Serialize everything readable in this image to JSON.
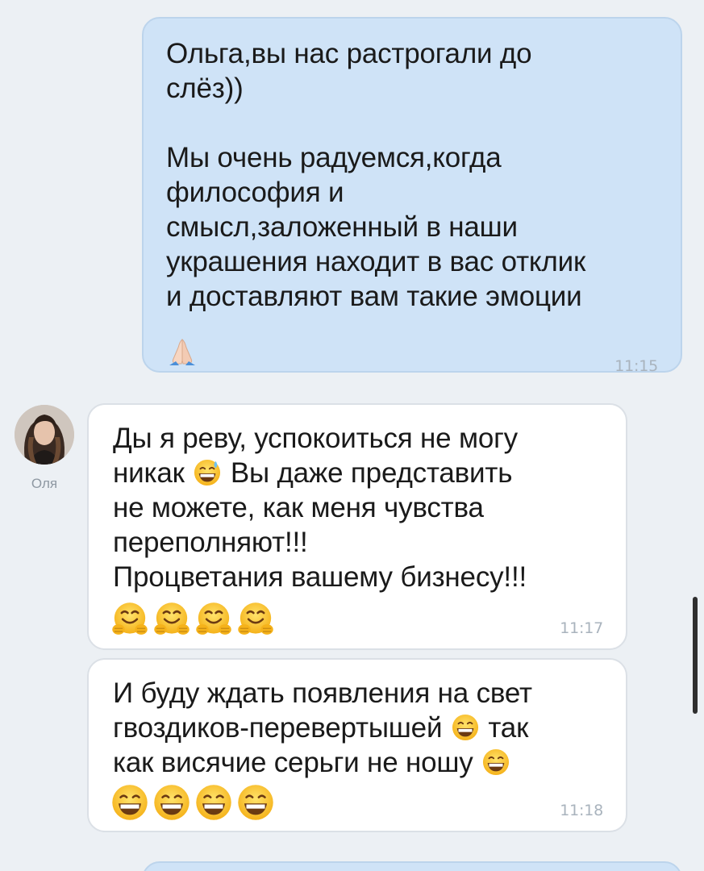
{
  "messages": [
    {
      "direction": "outgoing",
      "text": "Ольга,вы нас растрогали до\nслёз))\n\nМы очень радуемся,когда\nфилософия и\nсмысл,заложенный в наши\nукрашения находит в вас отклик\nи доставляют вам такие эмоции",
      "emoji": [
        "folded-hands"
      ],
      "time": "11:15"
    },
    {
      "direction": "incoming",
      "sender": "Оля",
      "text_before_emoji": "Ды я реву, успокоиться не могу\nникак",
      "inline_emoji": "grinning-sweat",
      "text_after_emoji": "Вы даже представить\nне можете, как меня чувства\nпереполняют!!!\nПроцветания вашему бизнесу!!!",
      "emoji": [
        "hugging-face",
        "hugging-face",
        "hugging-face",
        "hugging-face"
      ],
      "time": "11:17"
    },
    {
      "direction": "incoming",
      "sender": "Оля",
      "text_line1": "И буду ждать появления на свет",
      "text_line2_before": "гвоздиков-перевертышей",
      "text_line2_after": "так",
      "text_line3": "как висячие серьги не ношу",
      "inline_emoji": "grinning-face",
      "emoji": [
        "grinning-face",
        "grinning-face",
        "grinning-face",
        "grinning-face"
      ],
      "time": "11:18"
    }
  ],
  "colors": {
    "background": "#ecf0f4",
    "outgoing_bubble": "#cfe3f7",
    "incoming_bubble": "#ffffff",
    "timestamp": "#a9b3bd"
  }
}
